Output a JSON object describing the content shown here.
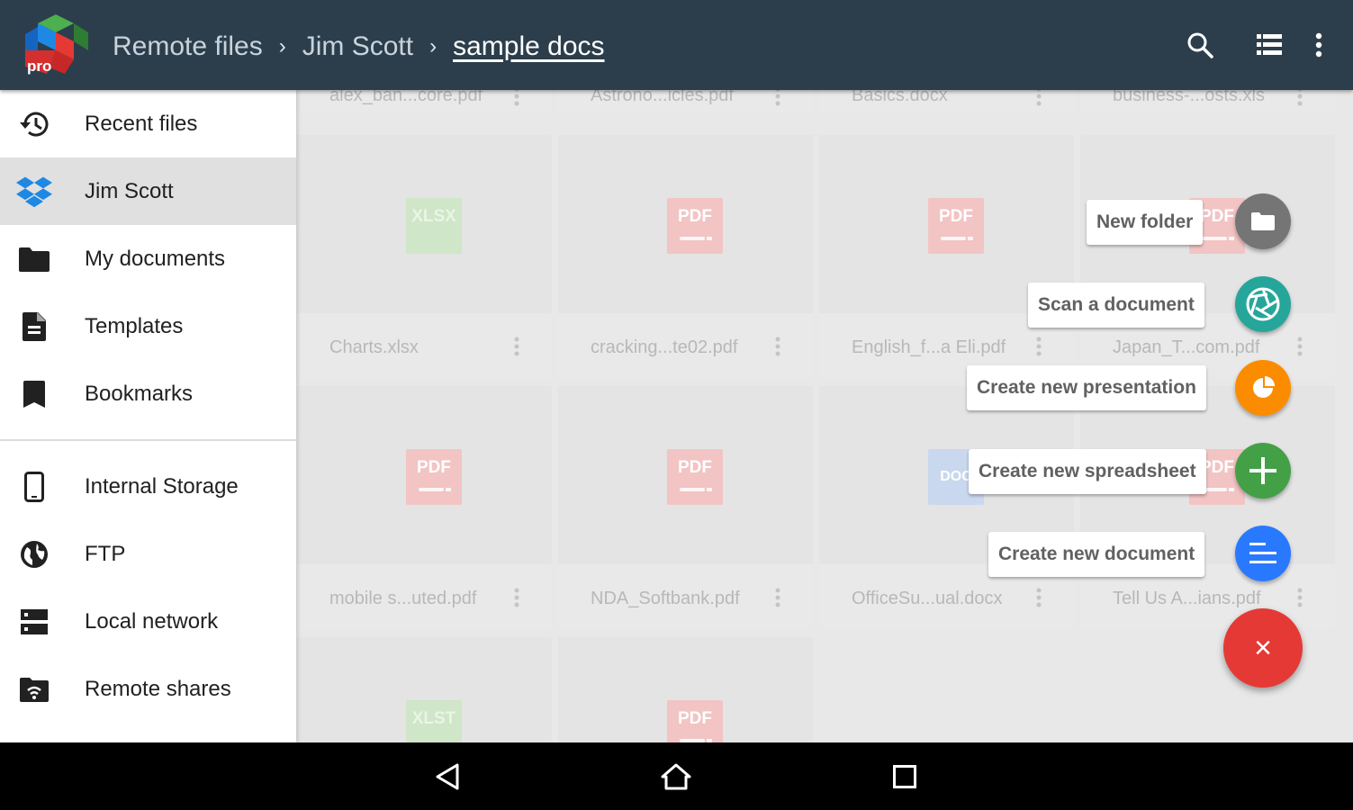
{
  "app": {
    "logo_text": "pro"
  },
  "breadcrumb": {
    "items": [
      "Remote files",
      "Jim Scott",
      "sample docs"
    ],
    "separator": "›"
  },
  "toolbar": {
    "icons": [
      "search-icon",
      "list-view-icon",
      "more-vert-icon"
    ]
  },
  "drawer": {
    "items": [
      {
        "label": "Recent files",
        "icon": "history-icon",
        "active": false
      },
      {
        "label": "Jim Scott",
        "icon": "dropbox-icon",
        "active": true
      },
      {
        "label": "My documents",
        "icon": "folder-icon",
        "active": false
      },
      {
        "label": "Templates",
        "icon": "document-icon",
        "active": false
      },
      {
        "label": "Bookmarks",
        "icon": "bookmark-icon",
        "active": false
      },
      {
        "label": "Internal Storage",
        "icon": "phone-icon",
        "active": false
      },
      {
        "label": "FTP",
        "icon": "globe-icon",
        "active": false
      },
      {
        "label": "Local network",
        "icon": "server-icon",
        "active": false
      },
      {
        "label": "Remote shares",
        "icon": "remote-share-icon",
        "active": false
      }
    ]
  },
  "files": [
    {
      "name": "alex_ban...core.pdf",
      "type": "PDF"
    },
    {
      "name": "Astrono...icles.pdf",
      "type": "PDF"
    },
    {
      "name": "Basics.docx",
      "type": "DOC"
    },
    {
      "name": "business-...osts.xls",
      "type": "XLS"
    },
    {
      "name": "Charts.xlsx",
      "type": "XLSX"
    },
    {
      "name": "cracking...te02.pdf",
      "type": "PDF"
    },
    {
      "name": "English_f...a Eli.pdf",
      "type": "PDF"
    },
    {
      "name": "Japan_T...com.pdf",
      "type": "PDF"
    },
    {
      "name": "mobile s...uted.pdf",
      "type": "PDF"
    },
    {
      "name": "NDA_Softbank.pdf",
      "type": "PDF"
    },
    {
      "name": "OfficeSu...ual.docx",
      "type": "DOC"
    },
    {
      "name": "Tell Us A...ians.pdf",
      "type": "PDF"
    },
    {
      "name": "",
      "type": "XLST"
    },
    {
      "name": "",
      "type": "PDF"
    }
  ],
  "fab_menu": {
    "new_folder": "New folder",
    "scan": "Scan a document",
    "presentation": "Create new presentation",
    "spreadsheet": "Create new spreadsheet",
    "document": "Create new document",
    "close_glyph": "×"
  },
  "colors": {
    "appbar": "#2c3e4c",
    "pdf": "#f4a6a6",
    "xlsx": "#b9dbb0",
    "doc": "#a9c4ea",
    "fab_red": "#e53935",
    "fab_folder": "#757575",
    "fab_scan": "#26a69a",
    "fab_presentation": "#fb8c00",
    "fab_spreadsheet": "#43a047",
    "fab_document": "#2979ff"
  },
  "system_nav": [
    "back-icon",
    "home-icon",
    "recents-icon"
  ]
}
